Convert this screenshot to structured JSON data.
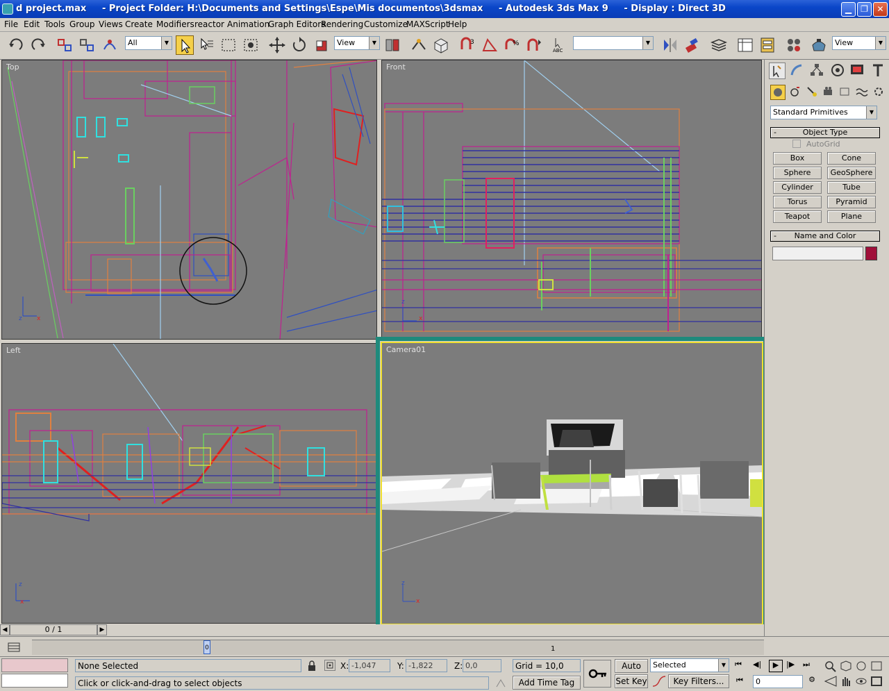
{
  "window": {
    "title": "d project.max     - Project Folder: H:\\Documents and Settings\\Espe\\Mis documentos\\3dsmax     - Autodesk 3ds Max 9     - Display : Direct 3D",
    "minimize": "▁",
    "maximize": "❐",
    "close": "✕"
  },
  "menu": [
    "File",
    "Edit",
    "Tools",
    "Group",
    "Views",
    "Create",
    "Modifiers",
    "reactor",
    "Animation",
    "Graph Editors",
    "Rendering",
    "Customize",
    "MAXScript",
    "Help"
  ],
  "toolbar": {
    "selection_filter": "All",
    "ref_coord": "View",
    "named_selection": "",
    "render_view": "View"
  },
  "viewports": {
    "top": "Top",
    "front": "Front",
    "left": "Left",
    "camera": "Camera01"
  },
  "command_panel": {
    "category": "Standard Primitives",
    "object_type_title": "Object Type",
    "autogrid": "AutoGrid",
    "buttons": [
      "Box",
      "Cone",
      "Sphere",
      "GeoSphere",
      "Cylinder",
      "Tube",
      "Torus",
      "Pyramid",
      "Teapot",
      "Plane"
    ],
    "name_color_title": "Name and Color",
    "name_value": "",
    "object_color": "#a0103a"
  },
  "timeline": {
    "frame_counter": "0 / 1",
    "slider_value": "0",
    "end_mark": "1"
  },
  "status": {
    "selection": "None Selected",
    "prompt": "Click or click-and-drag to select objects",
    "x_label": "X:",
    "x_value": "-1,047",
    "y_label": "Y:",
    "y_value": "-1,822",
    "z_label": "Z:",
    "z_value": "0,0",
    "grid": "Grid = 10,0",
    "add_time_tag": "Add Time Tag",
    "auto_key": "Auto Key",
    "set_key": "Set Key",
    "key_mode": "Selected",
    "key_filters": "Key Filters...",
    "current_frame": "0"
  }
}
